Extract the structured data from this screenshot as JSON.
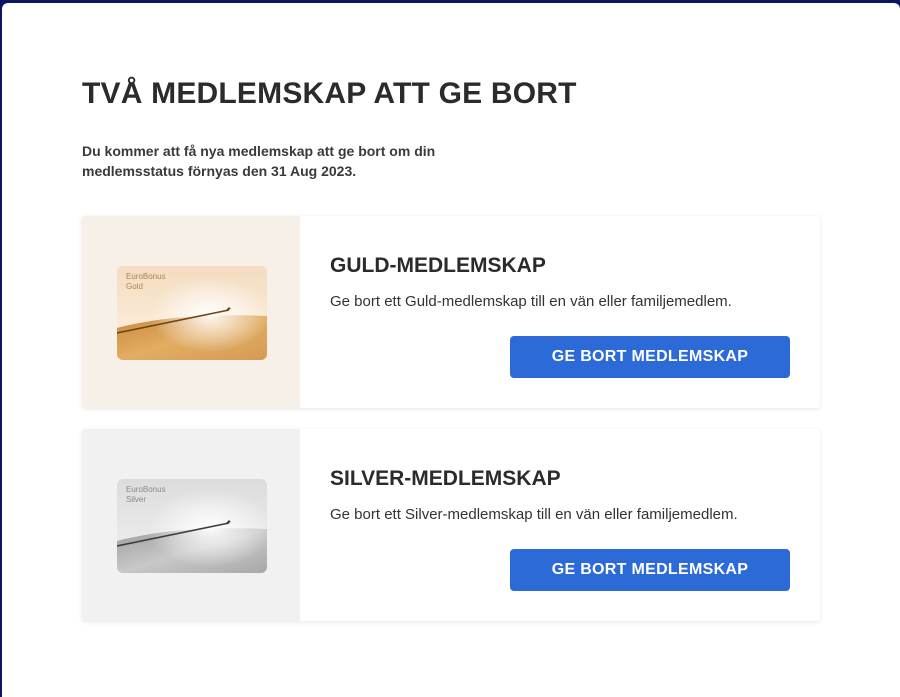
{
  "dialog": {
    "title": "TVÅ MEDLEMSKAP ATT GE BORT",
    "subtitle": "Du kommer att få nya medlemskap att ge bort om din medlemsstatus förnyas den 31 Aug 2023."
  },
  "memberships": [
    {
      "heading": "GULD-MEDLEMSKAP",
      "description": "Ge bort ett Guld-medlemskap till en vän eller familjemedlem.",
      "button_label": "GE BORT MEDLEMSKAP",
      "card": {
        "brand": "EuroBonus",
        "tier": "Gold"
      }
    },
    {
      "heading": "SILVER-MEDLEMSKAP",
      "description": "Ge bort ett Silver-medlemskap till en vän eller familjemedlem.",
      "button_label": "GE BORT MEDLEMSKAP",
      "card": {
        "brand": "EuroBonus",
        "tier": "Silver"
      }
    }
  ],
  "colors": {
    "accent": "#2c6ad8",
    "backdrop": "#0b1560",
    "gold": "#d9a25a",
    "silver": "#b8b8b8"
  }
}
